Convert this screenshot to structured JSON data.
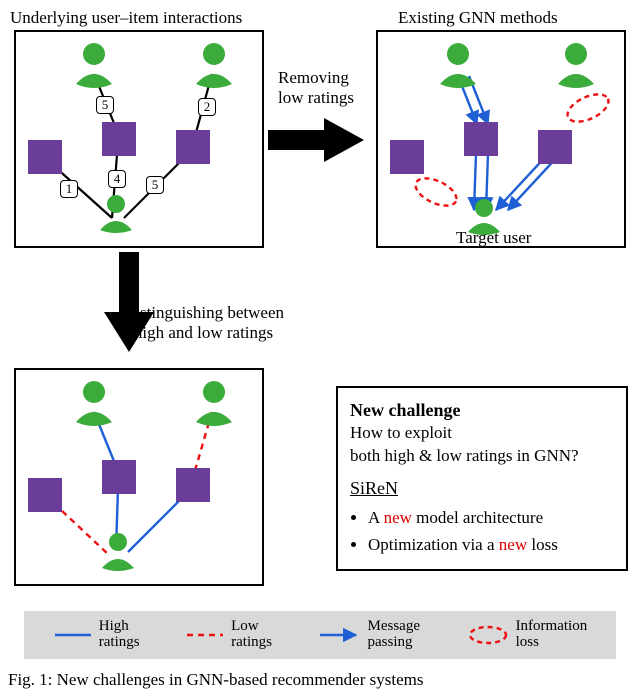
{
  "titles": {
    "underlying": "Underlying user–item interactions",
    "existing": "Existing GNN methods",
    "removing": "Removing\nlow ratings",
    "distinguishing": "Distinguishing between\nhigh and low ratings",
    "target_user": "Target user"
  },
  "ratings": {
    "left_item_bottom_user": "1",
    "top_left_user_item": "5",
    "mid_item_bottom_user": "4",
    "right_item_bottom_user": "5",
    "top_right_user_item": "2"
  },
  "challenge": {
    "heading": "New challenge",
    "question_l1": "How to exploit",
    "question_l2": "both high & low ratings in GNN?",
    "method": "SiReN",
    "bullet1_pre": "A ",
    "bullet1_red": "new",
    "bullet1_post": " model architecture",
    "bullet2_pre": "Optimization via a ",
    "bullet2_red": "new",
    "bullet2_post": " loss"
  },
  "legend": {
    "high": "High\nratings",
    "low": "Low\nratings",
    "msg": "Message\npassing",
    "info": "Information\nloss"
  },
  "caption": "Fig. 1: New challenges in GNN-based recommender systems"
}
